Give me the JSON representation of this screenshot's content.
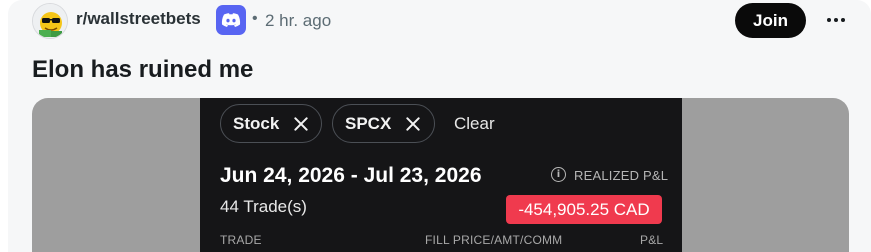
{
  "post": {
    "subreddit": "r/wallstreetbets",
    "separator": "•",
    "time_ago": "2 hr. ago",
    "join_label": "Join",
    "title": "Elon has ruined me",
    "icons": {
      "avatar": "subreddit-avatar",
      "badge": "discord-icon",
      "more": "more-options-icon"
    }
  },
  "trade_screenshot": {
    "filters": [
      {
        "label": "Stock"
      },
      {
        "label": "SPCX"
      }
    ],
    "clear_label": "Clear",
    "date_range": "Jun 24, 2026 - Jul 23, 2026",
    "trade_count": "44 Trade(s)",
    "realized_label": "REALIZED P&L",
    "realized_value": "-454,905.25 CAD",
    "columns": [
      "TRADE",
      "FILL PRICE/AMT/COMM",
      "P&L"
    ],
    "colors": {
      "loss_badge": "#f03a4e",
      "panel_bg": "#151517"
    }
  },
  "colors": {
    "join_bg": "#0a0a0a",
    "discord": "#5865f2"
  }
}
